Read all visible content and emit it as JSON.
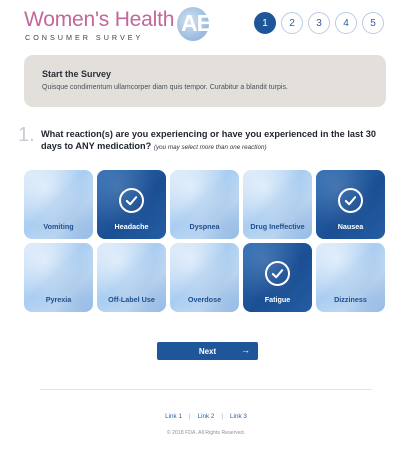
{
  "brand": {
    "title": "Women's Health",
    "logo_text": "AE",
    "subtitle": "CONSUMER SURVEY"
  },
  "steps": [
    {
      "label": "1",
      "active": true
    },
    {
      "label": "2",
      "active": false
    },
    {
      "label": "3",
      "active": false
    },
    {
      "label": "4",
      "active": false
    },
    {
      "label": "5",
      "active": false
    }
  ],
  "intro": {
    "title": "Start the Survey",
    "text": "Quisque condimentum ullamcorper diam quis tempor. Curabitur a blandit turpis."
  },
  "question": {
    "number": "1.",
    "text": "What reaction(s) are you experiencing or have you experienced in the last 30 days to ANY medication?",
    "note": "(you may select more than one reaction)"
  },
  "reactions": [
    {
      "label": "Vomiting",
      "selected": false
    },
    {
      "label": "Headache",
      "selected": true
    },
    {
      "label": "Dyspnea",
      "selected": false
    },
    {
      "label": "Drug Ineffective",
      "selected": false
    },
    {
      "label": "Nausea",
      "selected": true
    },
    {
      "label": "Pyrexia",
      "selected": false
    },
    {
      "label": "Off-Label Use",
      "selected": false
    },
    {
      "label": "Overdose",
      "selected": false
    },
    {
      "label": "Fatigue",
      "selected": true
    },
    {
      "label": "Dizziness",
      "selected": false
    }
  ],
  "next_button": {
    "label": "Next",
    "arrow": "→"
  },
  "footer": {
    "links": [
      "Link 1",
      "Link 2",
      "Link 3"
    ],
    "copyright": "© 2018 FDA. All Rights Reserved."
  },
  "colors": {
    "brand_pink": "#c2679a",
    "primary_blue": "#1e5699",
    "tile_light": "#a9cdf1",
    "intro_bg": "#e3e0dc"
  },
  "icons": {
    "check": "check-icon",
    "next_arrow": "arrow-right-icon"
  }
}
